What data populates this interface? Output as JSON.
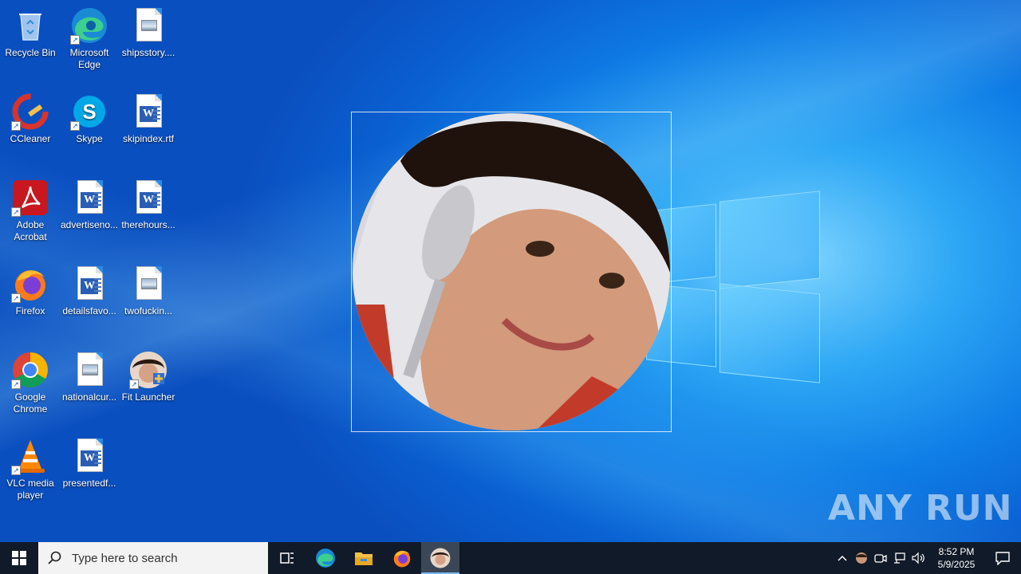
{
  "desktop": {
    "icons": [
      {
        "label": "Recycle Bin",
        "icon": "recycle-bin-icon"
      },
      {
        "label": "Microsoft Edge",
        "icon": "edge-icon"
      },
      {
        "label": "shipsstory....",
        "icon": "image-file-icon"
      },
      {
        "label": "CCleaner",
        "icon": "ccleaner-icon"
      },
      {
        "label": "Skype",
        "icon": "skype-icon"
      },
      {
        "label": "skipindex.rtf",
        "icon": "word-document-icon"
      },
      {
        "label": "Adobe Acrobat",
        "icon": "acrobat-icon"
      },
      {
        "label": "advertiseno...",
        "icon": "word-document-icon"
      },
      {
        "label": "therehours...",
        "icon": "word-document-icon"
      },
      {
        "label": "Firefox",
        "icon": "firefox-icon"
      },
      {
        "label": "detailsfavo...",
        "icon": "word-document-icon"
      },
      {
        "label": "twofuckin...",
        "icon": "image-file-icon"
      },
      {
        "label": "Google Chrome",
        "icon": "chrome-icon"
      },
      {
        "label": "nationalcur...",
        "icon": "image-file-icon"
      },
      {
        "label": "Fit Launcher",
        "icon": "fit-launcher-icon"
      },
      {
        "label": "VLC media player",
        "icon": "vlc-icon"
      },
      {
        "label": "presentedf...",
        "icon": "word-document-icon"
      }
    ]
  },
  "watermark": {
    "text": "ANY RUN"
  },
  "taskbar": {
    "search_placeholder": "Type here to search",
    "apps": [
      "task-view-icon",
      "edge-icon",
      "file-explorer-icon",
      "firefox-icon",
      "fit-launcher-icon"
    ],
    "active_app": "fit-launcher-icon",
    "clock_time": "8:52 PM",
    "clock_date": "5/9/2025"
  },
  "colors": {
    "taskbar": "#101a28",
    "accent": "#76b9ed",
    "desktop": "#0f7ee6"
  }
}
